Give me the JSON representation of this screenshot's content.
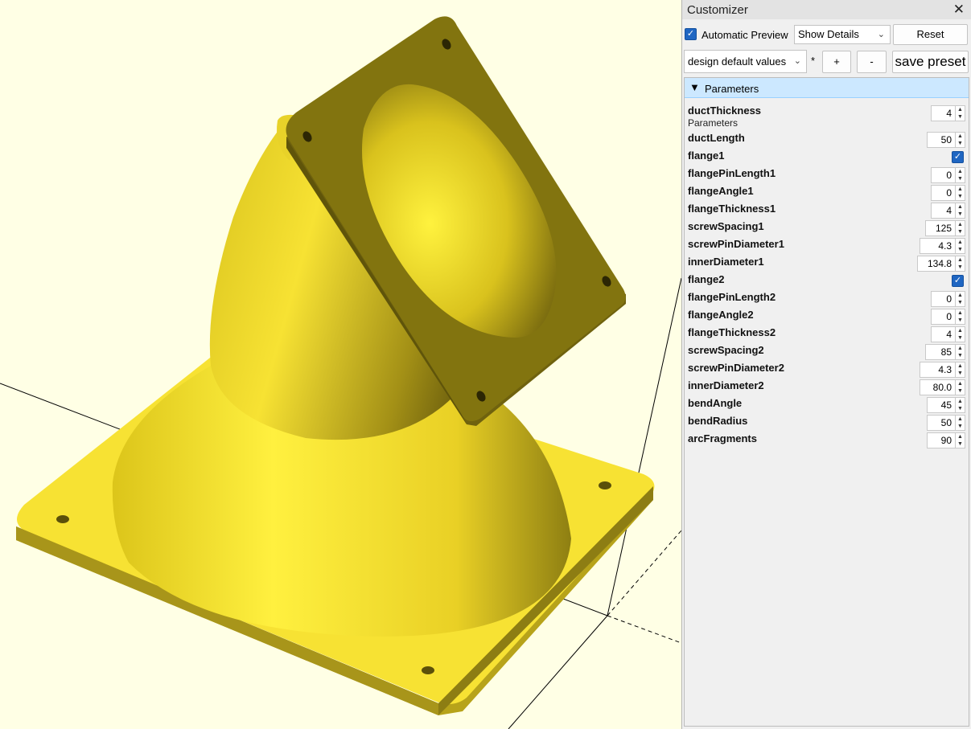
{
  "panel": {
    "title": "Customizer",
    "automatic_preview_label": "Automatic Preview",
    "automatic_preview_checked": true,
    "details_select": "Show Details",
    "reset_label": "Reset",
    "preset_select": "design default values",
    "dirty_marker": "*",
    "plus_label": "+",
    "minus_label": "-",
    "save_preset_label": "save preset"
  },
  "group": {
    "title": "Parameters",
    "params": [
      {
        "name": "ductThickness",
        "desc": "Parameters",
        "type": "number",
        "value": "4"
      },
      {
        "name": "ductLength",
        "type": "number",
        "value": "50"
      },
      {
        "name": "flange1",
        "type": "bool",
        "value": true
      },
      {
        "name": "flangePinLength1",
        "type": "number",
        "value": "0"
      },
      {
        "name": "flangeAngle1",
        "type": "number",
        "value": "0"
      },
      {
        "name": "flangeThickness1",
        "type": "number",
        "value": "4"
      },
      {
        "name": "screwSpacing1",
        "type": "number",
        "value": "125"
      },
      {
        "name": "screwPinDiameter1",
        "type": "number",
        "value": "4.3"
      },
      {
        "name": "innerDiameter1",
        "type": "number",
        "value": "134.8"
      },
      {
        "name": "flange2",
        "type": "bool",
        "value": true
      },
      {
        "name": "flangePinLength2",
        "type": "number",
        "value": "0"
      },
      {
        "name": "flangeAngle2",
        "type": "number",
        "value": "0"
      },
      {
        "name": "flangeThickness2",
        "type": "number",
        "value": "4"
      },
      {
        "name": "screwSpacing2",
        "type": "number",
        "value": "85"
      },
      {
        "name": "screwPinDiameter2",
        "type": "number",
        "value": "4.3"
      },
      {
        "name": "innerDiameter2",
        "type": "number",
        "value": "80.0"
      },
      {
        "name": "bendAngle",
        "type": "number",
        "value": "45"
      },
      {
        "name": "bendRadius",
        "type": "number",
        "value": "50"
      },
      {
        "name": "arcFragments",
        "type": "number",
        "value": "90"
      }
    ]
  },
  "icons": {
    "close": "close-icon",
    "checkmark": "checkmark-icon",
    "dropdown": "chevron-down-icon",
    "collapse": "triangle-down-icon",
    "spin_up": "arrow-up-icon",
    "spin_down": "arrow-down-icon"
  },
  "colors": {
    "viewport_bg": "#ffffe5",
    "model_yellow": "#f7e233",
    "model_dark": "#7b6d12",
    "accent": "#1f66c2",
    "group_header": "#cce8ff"
  }
}
